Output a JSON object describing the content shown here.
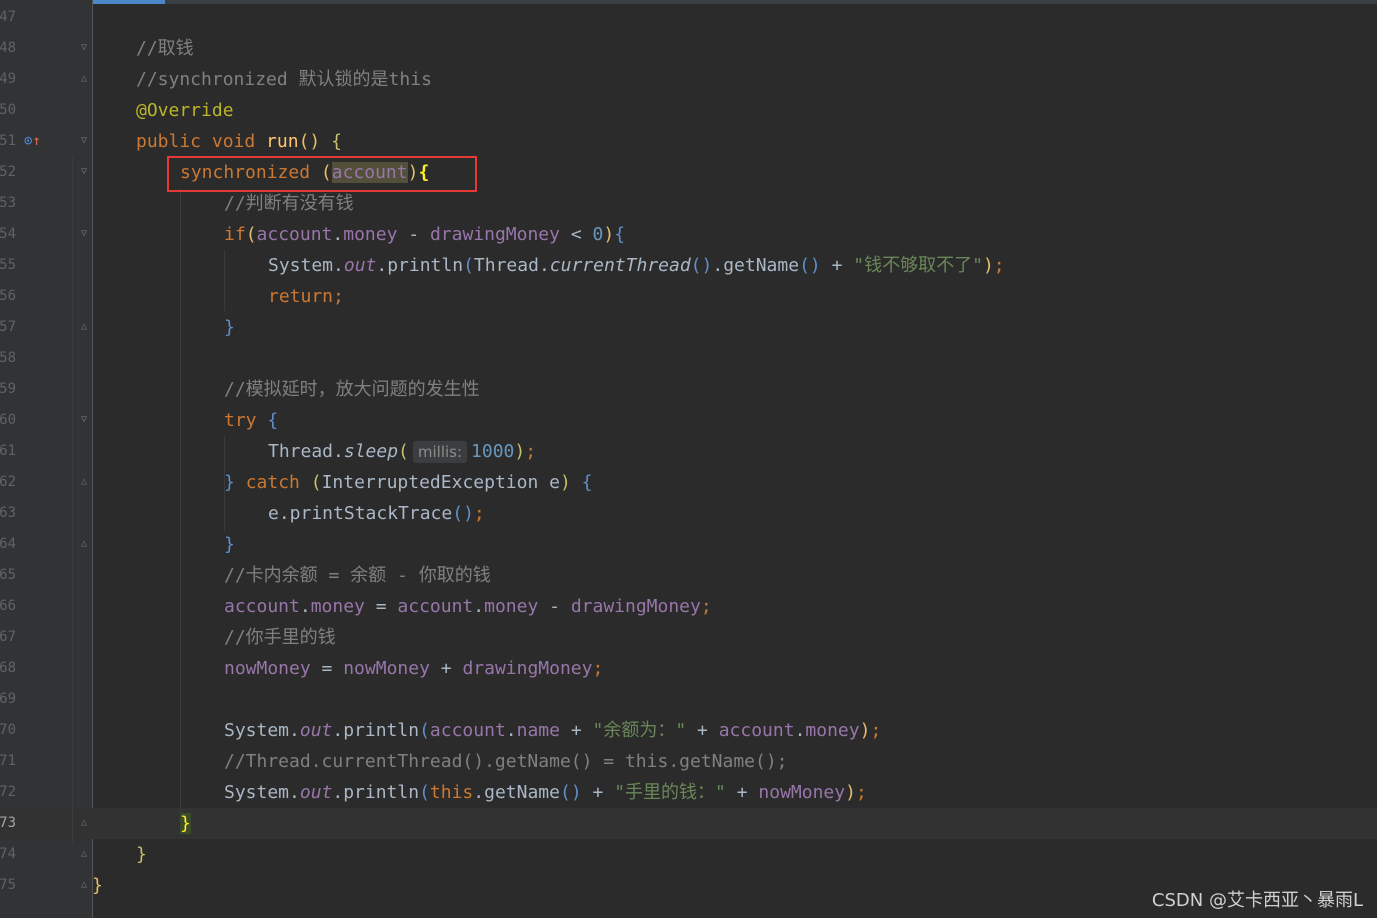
{
  "editor": {
    "theme": "darcula",
    "colors": {
      "background": "#2b2b2b",
      "gutter": "#313335",
      "highlight_box": "#e53935"
    },
    "current_line_number": 73,
    "lines": [
      {
        "n": "47",
        "segments": []
      },
      {
        "n": "48",
        "segments": [
          {
            "t": "//取钱",
            "c": "cm"
          }
        ]
      },
      {
        "n": "49",
        "segments": [
          {
            "t": "//synchronized 默认锁的是this",
            "c": "cm"
          }
        ]
      },
      {
        "n": "50",
        "segments": [
          {
            "t": "@Override",
            "c": "ann"
          }
        ]
      },
      {
        "n": "51",
        "segments": [
          {
            "t": "public ",
            "c": "kw"
          },
          {
            "t": "void ",
            "c": "kw"
          },
          {
            "t": "run",
            "c": "fn"
          },
          {
            "t": "() ",
            "c": "p1"
          },
          {
            "t": "{",
            "c": "p3"
          }
        ]
      },
      {
        "n": "52",
        "segments": [
          {
            "t": "synchronized ",
            "c": "kw"
          },
          {
            "t": "(",
            "c": "p1"
          },
          {
            "t": "account",
            "c": "fld hl"
          },
          {
            "t": ")",
            "c": "p1"
          },
          {
            "t": "{",
            "c": "brace-match"
          }
        ]
      },
      {
        "n": "53",
        "segments": [
          {
            "t": "//判断有没有钱",
            "c": "cm"
          }
        ]
      },
      {
        "n": "54",
        "segments": [
          {
            "t": "if",
            "c": "kw"
          },
          {
            "t": "(",
            "c": "p1"
          },
          {
            "t": "account",
            "c": "fld"
          },
          {
            "t": ".",
            "c": ""
          },
          {
            "t": "money",
            "c": "fld"
          },
          {
            "t": " - ",
            "c": ""
          },
          {
            "t": "drawingMoney",
            "c": "fld"
          },
          {
            "t": " < ",
            "c": ""
          },
          {
            "t": "0",
            "c": "num"
          },
          {
            "t": ")",
            "c": "p1"
          },
          {
            "t": "{",
            "c": "p2"
          }
        ]
      },
      {
        "n": "55",
        "segments": [
          {
            "t": "System.",
            "c": ""
          },
          {
            "t": "out",
            "c": "st"
          },
          {
            "t": ".println",
            "c": ""
          },
          {
            "t": "(",
            "c": "p2"
          },
          {
            "t": "Thread.",
            "c": ""
          },
          {
            "t": "currentThread",
            "c": "it"
          },
          {
            "t": "()",
            "c": "p2"
          },
          {
            "t": ".getName",
            "c": ""
          },
          {
            "t": "()",
            "c": "p2"
          },
          {
            "t": " + ",
            "c": ""
          },
          {
            "t": "\"钱不够取不了\"",
            "c": "str"
          },
          {
            "t": ")",
            "c": "p1"
          },
          {
            "t": ";",
            "c": "kw"
          }
        ]
      },
      {
        "n": "56",
        "segments": [
          {
            "t": "return",
            "c": "kw"
          },
          {
            "t": ";",
            "c": "kw"
          }
        ]
      },
      {
        "n": "57",
        "segments": [
          {
            "t": "}",
            "c": "p2"
          }
        ]
      },
      {
        "n": "58",
        "segments": []
      },
      {
        "n": "59",
        "segments": [
          {
            "t": "//模拟延时，放大问题的发生性",
            "c": "cm"
          }
        ]
      },
      {
        "n": "60",
        "segments": [
          {
            "t": "try ",
            "c": "kw"
          },
          {
            "t": "{",
            "c": "p2"
          }
        ]
      },
      {
        "n": "61",
        "segments": [
          {
            "t": "Thread.",
            "c": ""
          },
          {
            "t": "sleep",
            "c": "it"
          },
          {
            "t": "(",
            "c": "p3"
          },
          {
            "hint": "millis:"
          },
          {
            "t": "1000",
            "c": "num"
          },
          {
            "t": ")",
            "c": "p3"
          },
          {
            "t": ";",
            "c": "kw"
          }
        ]
      },
      {
        "n": "62",
        "segments": [
          {
            "t": "} ",
            "c": "p2"
          },
          {
            "t": "catch ",
            "c": "kw"
          },
          {
            "t": "(",
            "c": "p3"
          },
          {
            "t": "InterruptedException e",
            "c": ""
          },
          {
            "t": ") ",
            "c": "p3"
          },
          {
            "t": "{",
            "c": "p2"
          }
        ]
      },
      {
        "n": "63",
        "segments": [
          {
            "t": "e.printStackTrace",
            "c": ""
          },
          {
            "t": "()",
            "c": "p2"
          },
          {
            "t": ";",
            "c": "kw"
          }
        ]
      },
      {
        "n": "64",
        "segments": [
          {
            "t": "}",
            "c": "p2"
          }
        ]
      },
      {
        "n": "65",
        "segments": [
          {
            "t": "//卡内余额 = 余额 - 你取的钱",
            "c": "cm"
          }
        ]
      },
      {
        "n": "66",
        "segments": [
          {
            "t": "account",
            "c": "fld"
          },
          {
            "t": ".",
            "c": ""
          },
          {
            "t": "money",
            "c": "fld"
          },
          {
            "t": " = ",
            "c": ""
          },
          {
            "t": "account",
            "c": "fld"
          },
          {
            "t": ".",
            "c": ""
          },
          {
            "t": "money",
            "c": "fld"
          },
          {
            "t": " - ",
            "c": ""
          },
          {
            "t": "drawingMoney",
            "c": "fld"
          },
          {
            "t": ";",
            "c": "kw"
          }
        ]
      },
      {
        "n": "67",
        "segments": [
          {
            "t": "//你手里的钱",
            "c": "cm"
          }
        ]
      },
      {
        "n": "68",
        "segments": [
          {
            "t": "nowMoney",
            "c": "fld"
          },
          {
            "t": " = ",
            "c": ""
          },
          {
            "t": "nowMoney",
            "c": "fld"
          },
          {
            "t": " + ",
            "c": ""
          },
          {
            "t": "drawingMoney",
            "c": "fld"
          },
          {
            "t": ";",
            "c": "kw"
          }
        ]
      },
      {
        "n": "69",
        "segments": []
      },
      {
        "n": "70",
        "segments": [
          {
            "t": "System.",
            "c": ""
          },
          {
            "t": "out",
            "c": "st"
          },
          {
            "t": ".println",
            "c": ""
          },
          {
            "t": "(",
            "c": "p2"
          },
          {
            "t": "account",
            "c": "fld"
          },
          {
            "t": ".",
            "c": ""
          },
          {
            "t": "name",
            "c": "fld"
          },
          {
            "t": " + ",
            "c": ""
          },
          {
            "t": "\"余额为：\"",
            "c": "str"
          },
          {
            "t": " + ",
            "c": ""
          },
          {
            "t": "account",
            "c": "fld"
          },
          {
            "t": ".",
            "c": ""
          },
          {
            "t": "money",
            "c": "fld"
          },
          {
            "t": ")",
            "c": "p1"
          },
          {
            "t": ";",
            "c": "kw"
          }
        ]
      },
      {
        "n": "71",
        "segments": [
          {
            "t": "//Thread.currentThread().getName() = this.getName();",
            "c": "cm"
          }
        ]
      },
      {
        "n": "72",
        "segments": [
          {
            "t": "System.",
            "c": ""
          },
          {
            "t": "out",
            "c": "st"
          },
          {
            "t": ".println",
            "c": ""
          },
          {
            "t": "(",
            "c": "p2"
          },
          {
            "t": "this",
            "c": "kw"
          },
          {
            "t": ".getName",
            "c": ""
          },
          {
            "t": "()",
            "c": "p2"
          },
          {
            "t": " + ",
            "c": ""
          },
          {
            "t": "\"手里的钱：\"",
            "c": "str"
          },
          {
            "t": " + ",
            "c": ""
          },
          {
            "t": "nowMoney",
            "c": "fld"
          },
          {
            "t": ")",
            "c": "p1"
          },
          {
            "t": ";",
            "c": "kw"
          }
        ]
      },
      {
        "n": "73",
        "segments": [
          {
            "t": "}",
            "c": "cur-brace"
          }
        ]
      },
      {
        "n": "74",
        "segments": [
          {
            "t": "}",
            "c": "p3"
          }
        ]
      },
      {
        "n": "75",
        "segments": [
          {
            "t": "}",
            "c": "p1"
          }
        ]
      }
    ]
  },
  "watermark": "CSDN @艾卡西亚丶暴雨L"
}
